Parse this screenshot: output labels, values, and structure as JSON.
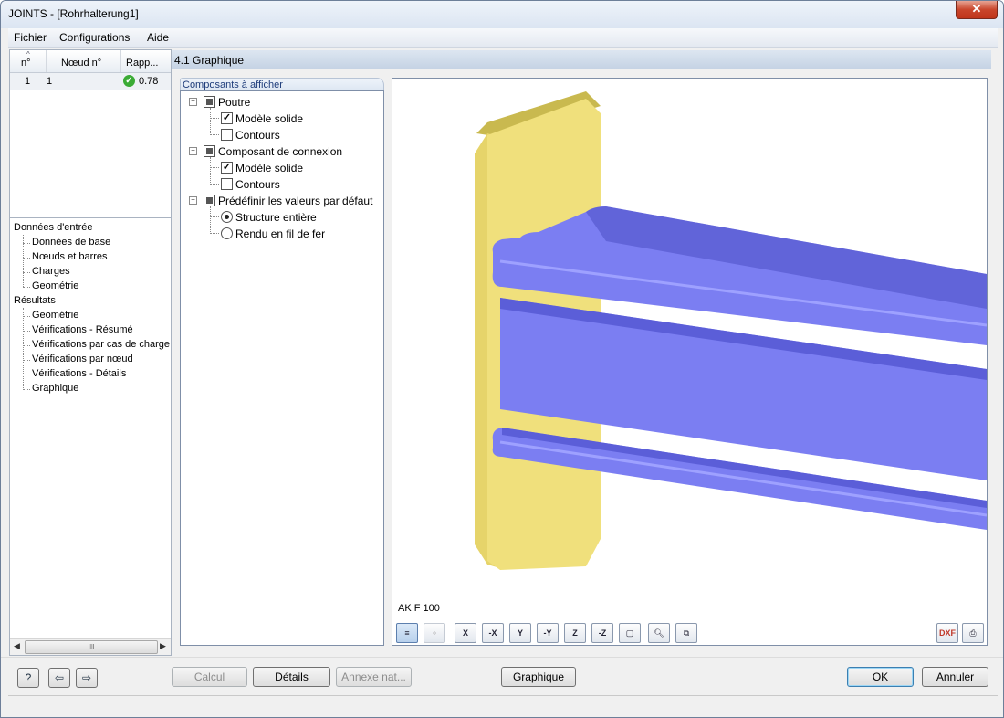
{
  "window": {
    "title": "JOINTS - [Rohrhalterung1]",
    "close_label": "✕"
  },
  "menu": [
    "Fichier",
    "Configurations",
    "Aide"
  ],
  "results_grid": {
    "columns": [
      "n°",
      "Nœud n°",
      "Rapp..."
    ],
    "rows": [
      {
        "no": "1",
        "node": "1",
        "ratio": "0.78"
      }
    ]
  },
  "navigator": {
    "groups": [
      {
        "label": "Données d'entrée",
        "items": [
          "Données de base",
          "Nœuds et barres",
          "Charges",
          "Geométrie"
        ]
      },
      {
        "label": "Résultats",
        "items": [
          "Geométrie",
          "Vérifications - Résumé",
          "Vérifications par cas de charge",
          "Vérifications par nœud",
          "Vérifications - Détails",
          "Graphique"
        ]
      }
    ],
    "scroll_thumb": "III"
  },
  "section": {
    "title": "4.1 Graphique"
  },
  "components": {
    "tab_label": "Composants à afficher",
    "groups": [
      {
        "label": "Poutre",
        "options": [
          {
            "label": "Modèle solide",
            "checked": true
          },
          {
            "label": "Contours",
            "checked": false
          }
        ]
      },
      {
        "label": "Composant de connexion",
        "options": [
          {
            "label": "Modèle solide",
            "checked": true
          },
          {
            "label": "Contours",
            "checked": false
          }
        ]
      },
      {
        "label": "Prédéfinir les valeurs par défaut",
        "radios": [
          {
            "label": "Structure entière",
            "selected": true
          },
          {
            "label": "Rendu en fil de fer",
            "selected": false
          }
        ]
      }
    ]
  },
  "graphic": {
    "label": "AK F 100",
    "colors": {
      "plate": "#f0e07c",
      "plate_side": "#c9b94f",
      "beam": "#7b7ef2",
      "beam_dark": "#4c4fc4"
    },
    "toolbar": {
      "x": "X",
      "neg_x": "-X",
      "y": "Y",
      "neg_y": "-Y",
      "z": "Z",
      "neg_z": "-Z",
      "dxf": "DXF"
    }
  },
  "buttons": {
    "calc": "Calcul",
    "details": "Détails",
    "annex": "Annexe nat...",
    "graphic": "Graphique",
    "ok": "OK",
    "cancel": "Annuler"
  }
}
